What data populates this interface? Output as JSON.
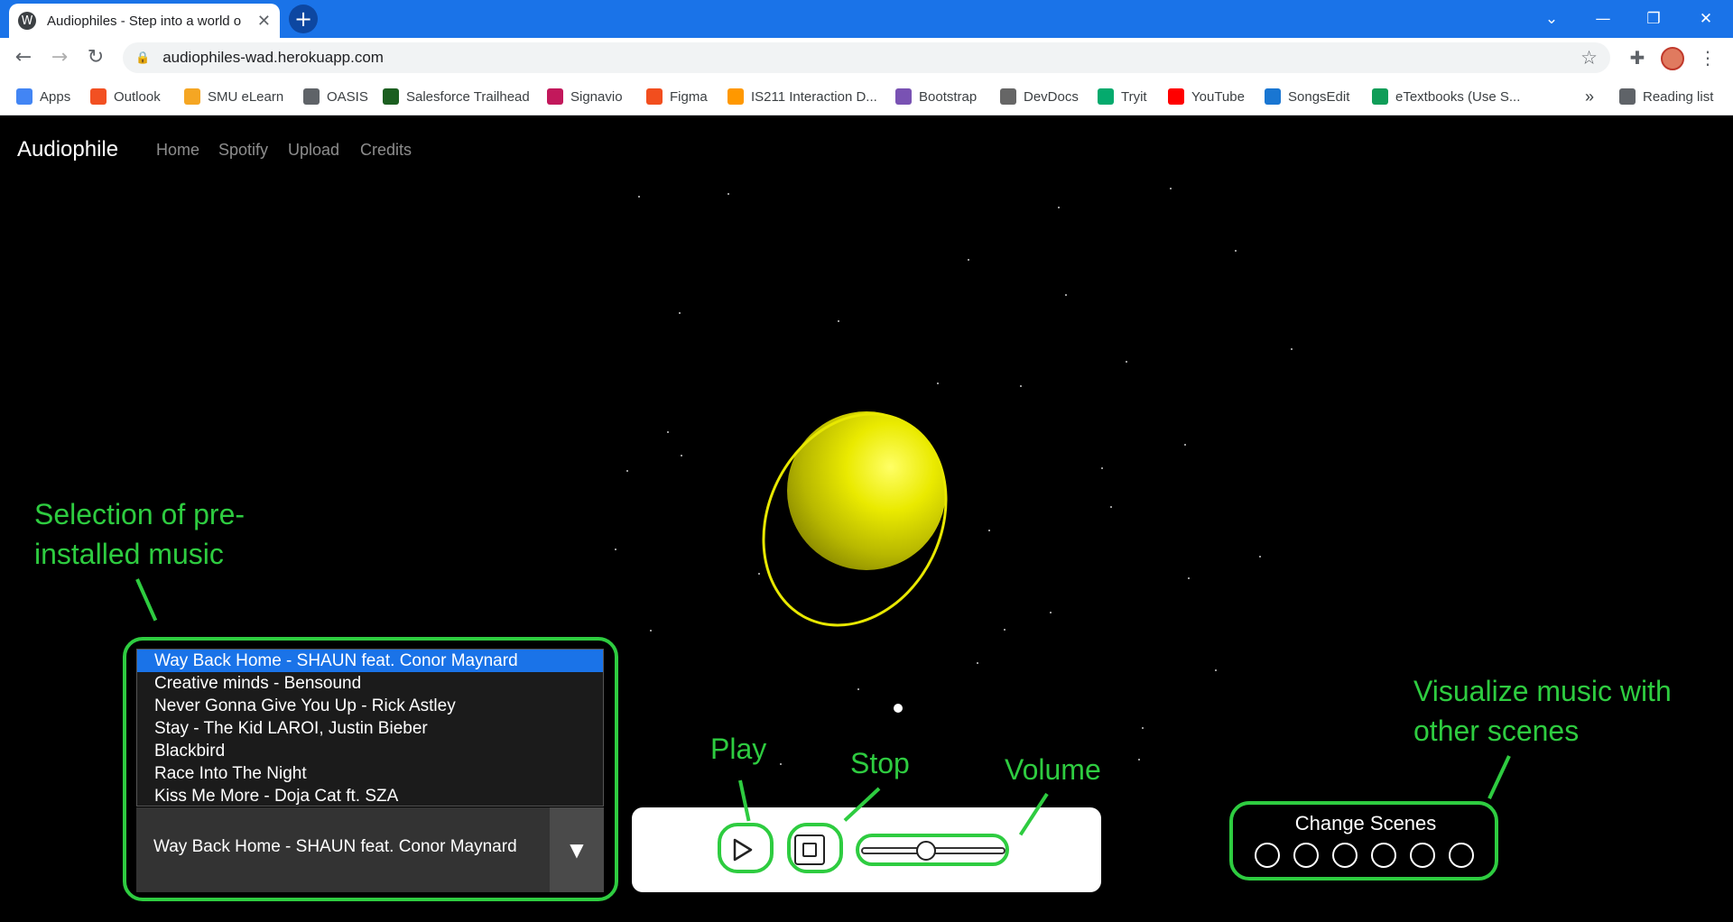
{
  "browser": {
    "tab_title": "Audiophiles - Step into a world o",
    "tab_favicon": "wordpress-icon",
    "url": "audiophiles-wad.herokuapp.com",
    "bookmarks": [
      {
        "label": "Apps",
        "icon": "apps-grid-icon",
        "color": "#4285f4"
      },
      {
        "label": "Outlook",
        "icon": "microsoft-icon",
        "color": "#f25022"
      },
      {
        "label": "SMU eLearn",
        "icon": "elearn-icon",
        "color": "#f5a623"
      },
      {
        "label": "OASIS",
        "icon": "globe-icon",
        "color": "#5f6368"
      },
      {
        "label": "Salesforce Trailhead",
        "icon": "trailhead-icon",
        "color": "#1b5e20"
      },
      {
        "label": "Signavio",
        "icon": "signavio-icon",
        "color": "#c2185b"
      },
      {
        "label": "Figma",
        "icon": "figma-icon",
        "color": "#f24e1e"
      },
      {
        "label": "IS211 Interaction D...",
        "icon": "folder-people-icon",
        "color": "#ff9800"
      },
      {
        "label": "Bootstrap",
        "icon": "bootstrap-icon",
        "color": "#7952b3"
      },
      {
        "label": "DevDocs",
        "icon": "devdocs-icon",
        "color": "#666666"
      },
      {
        "label": "Tryit",
        "icon": "w3schools-icon",
        "color": "#04aa6d"
      },
      {
        "label": "YouTube",
        "icon": "youtube-icon",
        "color": "#ff0000"
      },
      {
        "label": "SongsEdit",
        "icon": "songsedit-icon",
        "color": "#1976d2"
      },
      {
        "label": "eTextbooks (Use S...",
        "icon": "google-drive-icon",
        "color": "#0f9d58"
      }
    ],
    "overflow_label": "»",
    "reading_list_label": "Reading list"
  },
  "nav": {
    "brand": "Audiophile",
    "links": [
      "Home",
      "Spotify",
      "Upload",
      "Credits"
    ]
  },
  "annotations": {
    "music_selection": "Selection of pre-installed music",
    "play": "Play",
    "stop": "Stop",
    "volume": "Volume",
    "scenes": "Visualize music with other scenes"
  },
  "music": {
    "options": [
      "Way Back Home - SHAUN feat. Conor Maynard",
      "Creative minds - Bensound",
      "Never Gonna Give You Up - Rick Astley",
      "Stay - The Kid LAROI, Justin Bieber",
      "Blackbird",
      "Race Into The Night",
      "Kiss Me More - Doja Cat ft. SZA"
    ],
    "selected_index": 0,
    "selected_value": "Way Back Home - SHAUN feat. Conor Maynard"
  },
  "player": {
    "volume_level": 0.45
  },
  "scenes": {
    "heading": "Change Scenes",
    "count": 6
  },
  "colors": {
    "annotation": "#2ecc40",
    "planet": "#e8e800",
    "selected_option": "#1a73e8"
  }
}
